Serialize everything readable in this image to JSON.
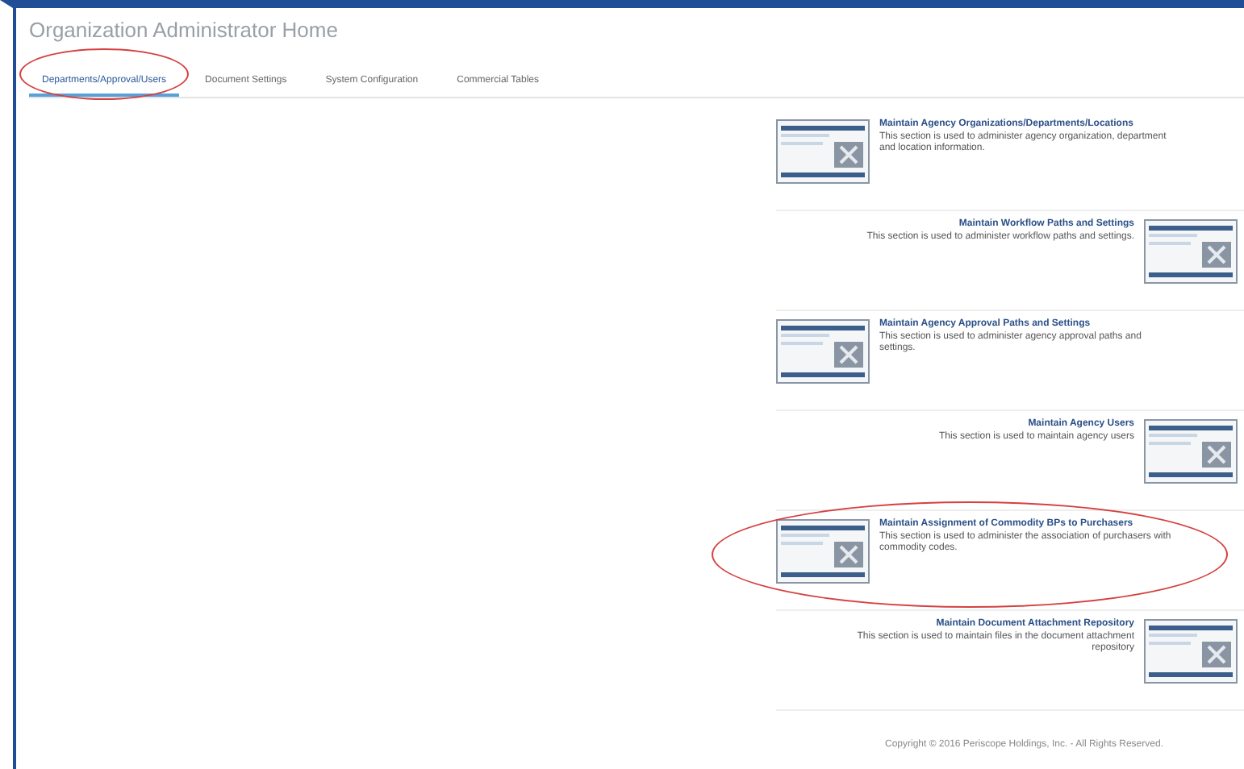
{
  "page_title": "Organization Administrator Home",
  "tabs": [
    {
      "label": "Departments/Approval/Users",
      "selected": true,
      "circled": true
    },
    {
      "label": "Document Settings",
      "selected": false,
      "circled": false
    },
    {
      "label": "System Configuration",
      "selected": false,
      "circled": false
    },
    {
      "label": "Commercial Tables",
      "selected": false,
      "circled": false
    }
  ],
  "sections": [
    {
      "kind": "icon-left",
      "title": "Maintain Agency Organizations/Departments/Locations",
      "description": "This section is used to administer agency organization, department and location information.",
      "circled": false
    },
    {
      "kind": "icon-right",
      "title": "Maintain Workflow Paths and Settings",
      "description": "This section is used to administer workflow paths and settings.",
      "circled": false
    },
    {
      "kind": "icon-left",
      "title": "Maintain Agency Approval Paths and Settings",
      "description": "This section is used to administer agency approval paths and settings.",
      "circled": false
    },
    {
      "kind": "icon-right",
      "title": "Maintain Agency Users",
      "description": "This section is used to maintain agency users",
      "circled": false
    },
    {
      "kind": "icon-left",
      "title": "Maintain Assignment of Commodity BPs to Purchasers",
      "description": "This section is used to administer the association of purchasers with commodity codes.",
      "circled": true
    },
    {
      "kind": "icon-right",
      "title": "Maintain Document Attachment Repository",
      "description": "This section is used to maintain files in the document attachment repository",
      "circled": false
    }
  ],
  "footer": "Copyright © 2016 Periscope Holdings, Inc. - All Rights Reserved."
}
